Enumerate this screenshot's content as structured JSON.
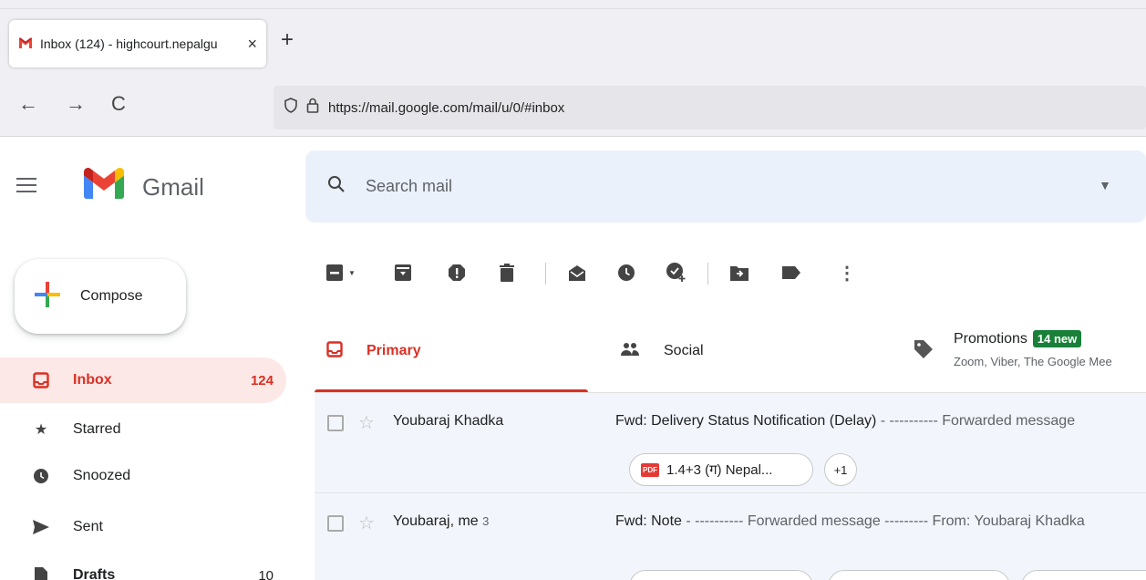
{
  "browser": {
    "tab_title": "Inbox (124) - highcourt.nepalgu",
    "new_tab": "+",
    "close": "×",
    "url": "https://mail.google.com/mail/u/0/#inbox",
    "back": "←",
    "forward": "→",
    "reload": "C"
  },
  "gmail": {
    "brand": "Gmail",
    "search_placeholder": "Search mail",
    "compose": "Compose"
  },
  "sidebar": {
    "items": [
      {
        "label": "Inbox",
        "count": "124"
      },
      {
        "label": "Starred",
        "count": ""
      },
      {
        "label": "Snoozed",
        "count": ""
      },
      {
        "label": "Sent",
        "count": ""
      },
      {
        "label": "Drafts",
        "count": "10"
      }
    ]
  },
  "tabs": {
    "primary": "Primary",
    "social": "Social",
    "promotions": "Promotions",
    "promotions_badge": "14 new",
    "promotions_sub": "Zoom, Viber, The Google Mee"
  },
  "emails": [
    {
      "sender": "Youbaraj Khadka",
      "sender_count": "",
      "subject": "Fwd: Delivery Status Notification (Delay)",
      "snippet": " - ---------- Forwarded message",
      "attachment": "1.4+3 (ग) Nepal...",
      "more": "+1"
    },
    {
      "sender": "Youbaraj, me",
      "sender_count": "3",
      "subject": "Fwd: Note",
      "snippet": " - ---------- Forwarded message --------- From: Youbaraj Khadka"
    }
  ],
  "colors": {
    "accent": "#d93025",
    "badge": "#188038"
  }
}
